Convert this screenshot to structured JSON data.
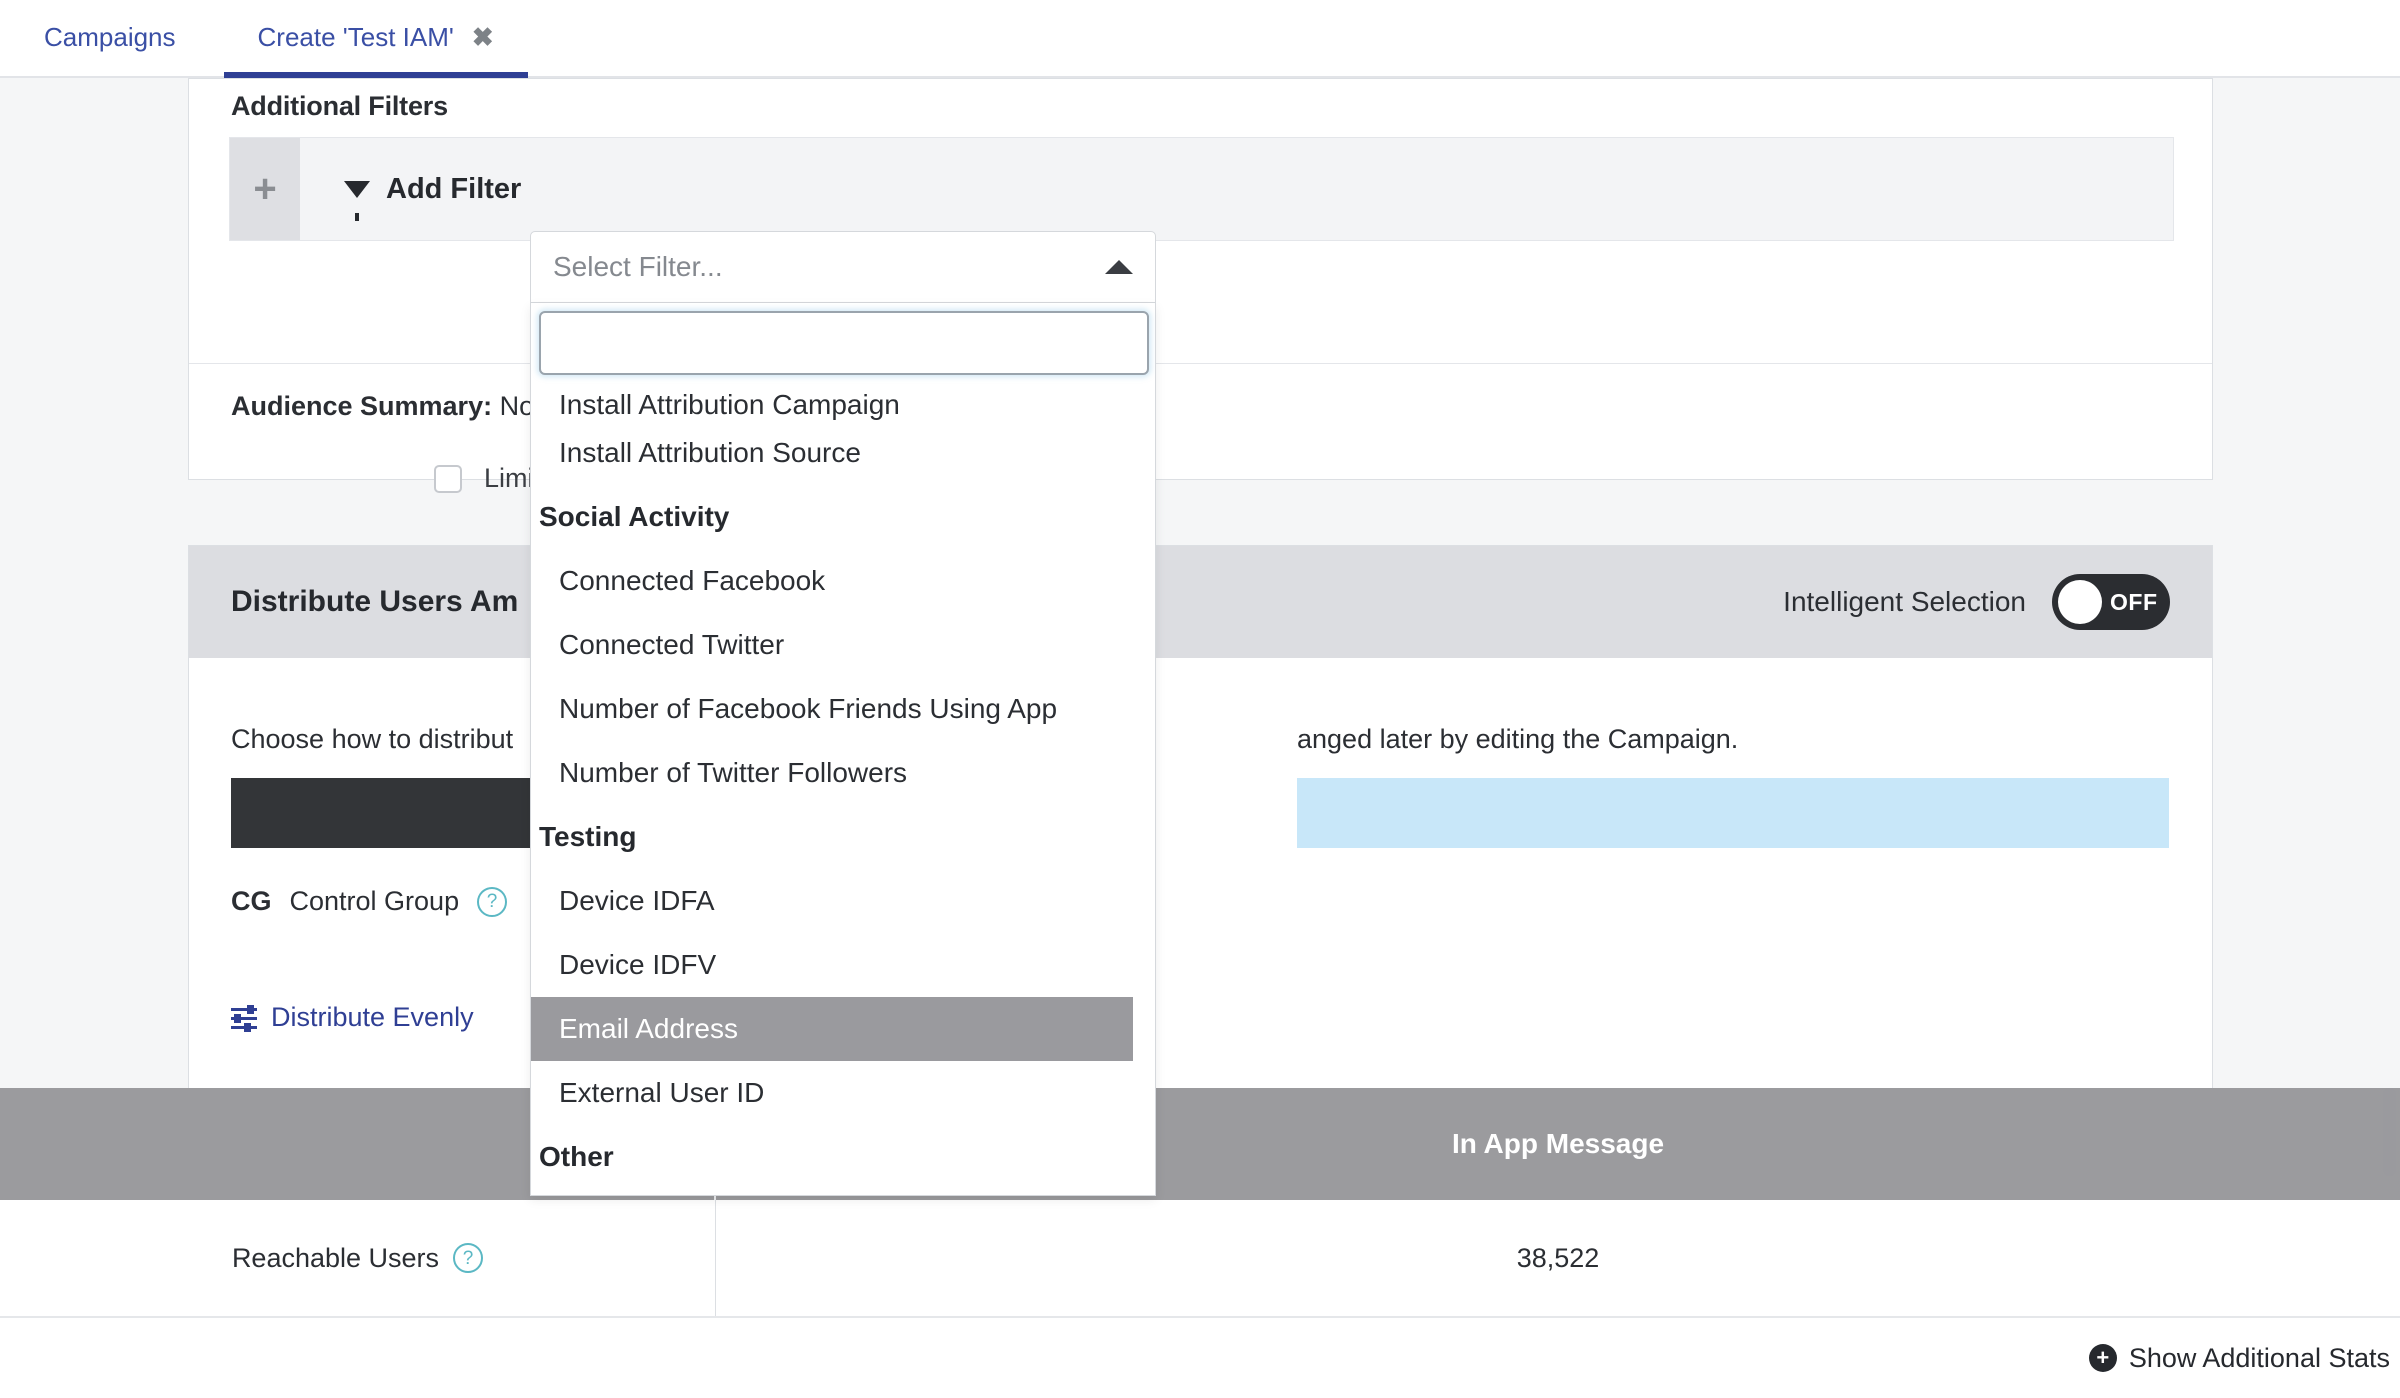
{
  "tabs": [
    {
      "label": "Campaigns",
      "active": false,
      "closable": false
    },
    {
      "label": "Create 'Test IAM'",
      "active": true,
      "closable": true,
      "close_icon": "close-icon"
    }
  ],
  "filters_card": {
    "title": "Additional Filters",
    "add_filter_label": "Add Filter",
    "plus_glyph": "+",
    "funnel_icon": "funnel-icon",
    "audience_summary_label": "Audience Summary:",
    "audience_summary_value": "No s",
    "limit_checkbox_label": "Limit the number of"
  },
  "select": {
    "placeholder": "Select Filter...",
    "value": "",
    "caret_icon": "caret-up-icon",
    "search_value": ""
  },
  "dropdown": {
    "items": [
      {
        "label": "Install Attribution Campaign",
        "type": "option",
        "clipped": true
      },
      {
        "label": "Install Attribution Source",
        "type": "option"
      },
      {
        "label": "Social Activity",
        "type": "group"
      },
      {
        "label": "Connected Facebook",
        "type": "option"
      },
      {
        "label": "Connected Twitter",
        "type": "option"
      },
      {
        "label": "Number of Facebook Friends Using App",
        "type": "option"
      },
      {
        "label": "Number of Twitter Followers",
        "type": "option"
      },
      {
        "label": "Testing",
        "type": "group"
      },
      {
        "label": "Device IDFA",
        "type": "option"
      },
      {
        "label": "Device IDFV",
        "type": "option"
      },
      {
        "label": "Email Address",
        "type": "option",
        "highlighted": true
      },
      {
        "label": "External User ID",
        "type": "option"
      },
      {
        "label": "Other",
        "type": "group"
      }
    ]
  },
  "distribute_card": {
    "title": "Distribute Users Am",
    "toggle_label": "Intelligent Selection",
    "toggle_state": "OFF",
    "description_left": "Choose how to distribut",
    "description_right": "anged later by editing the Campaign.",
    "control_group_abbr": "CG",
    "control_group_label": "Control Group",
    "help_glyph": "?",
    "links": [
      {
        "label": "Distribute Evenly",
        "icon": "sliders-icon"
      },
      {
        "label": "",
        "icon": "sliders-icon"
      }
    ],
    "colors": {
      "dark_bar": "#333538",
      "blue_bar": "#c8e7f9"
    }
  },
  "stats": {
    "columns": [
      "",
      "In App Message"
    ],
    "rows": [
      {
        "label": "Reachable Users",
        "help_glyph": "?",
        "value": "38,522"
      }
    ],
    "show_additional": "Show Additional Stats",
    "show_additional_icon": "plus-circle-icon"
  },
  "colors": {
    "accent": "#2f3f94",
    "tab_text": "#3a4fa5",
    "highlight": "#9a9a9e",
    "header_grey": "#9b9b9e",
    "blue_bar": "#c8e7f9"
  }
}
